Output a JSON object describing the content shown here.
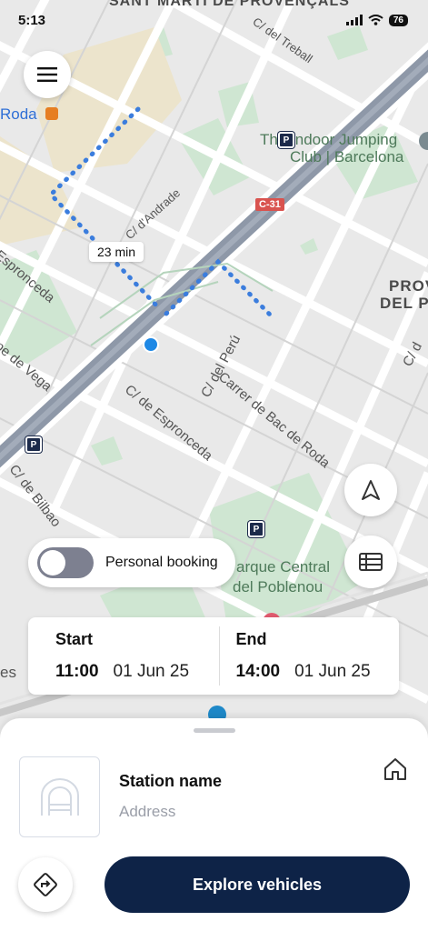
{
  "status_bar": {
    "time": "5:13",
    "battery": "76"
  },
  "map": {
    "labels": {
      "neighborhood_top": "SANT MARTÍ DE PROVENÇALS",
      "roda": "Roda",
      "treball": "C/ del Treball",
      "indoor_jumping_1": "The Indoor Jumping",
      "indoor_jumping_2": "Club | Barcelona",
      "andrade": "C/ d'Andrade",
      "road_c31": "C-31",
      "provencals_1": "PROV",
      "provencals_2": "DEL P",
      "espronceda_left": "Espronceda",
      "vega": "pe de Vega",
      "del_peru": "C/ del Perú",
      "espronceda_mid": "C/ de Espronceda",
      "carrer_bac_roda": "Carrer de Bac de Roda",
      "bilbao": "C/ de Bilbao",
      "parque_1": "arque Central",
      "parque_2": "del Poblenou",
      "es": "es",
      "c_right": "C/ d"
    },
    "duration": "23 min"
  },
  "toggle": {
    "label": "Personal booking",
    "on": false
  },
  "booking": {
    "start": {
      "title": "Start",
      "hour": "11:00",
      "date": "01 Jun 25"
    },
    "end": {
      "title": "End",
      "hour": "14:00",
      "date": "01 Jun 25"
    }
  },
  "station": {
    "name": "Station name",
    "address": "Address"
  },
  "actions": {
    "explore": "Explore vehicles"
  },
  "colors": {
    "primary": "#0e2347",
    "route": "#3b7ddd",
    "park": "#cfe6d2"
  }
}
